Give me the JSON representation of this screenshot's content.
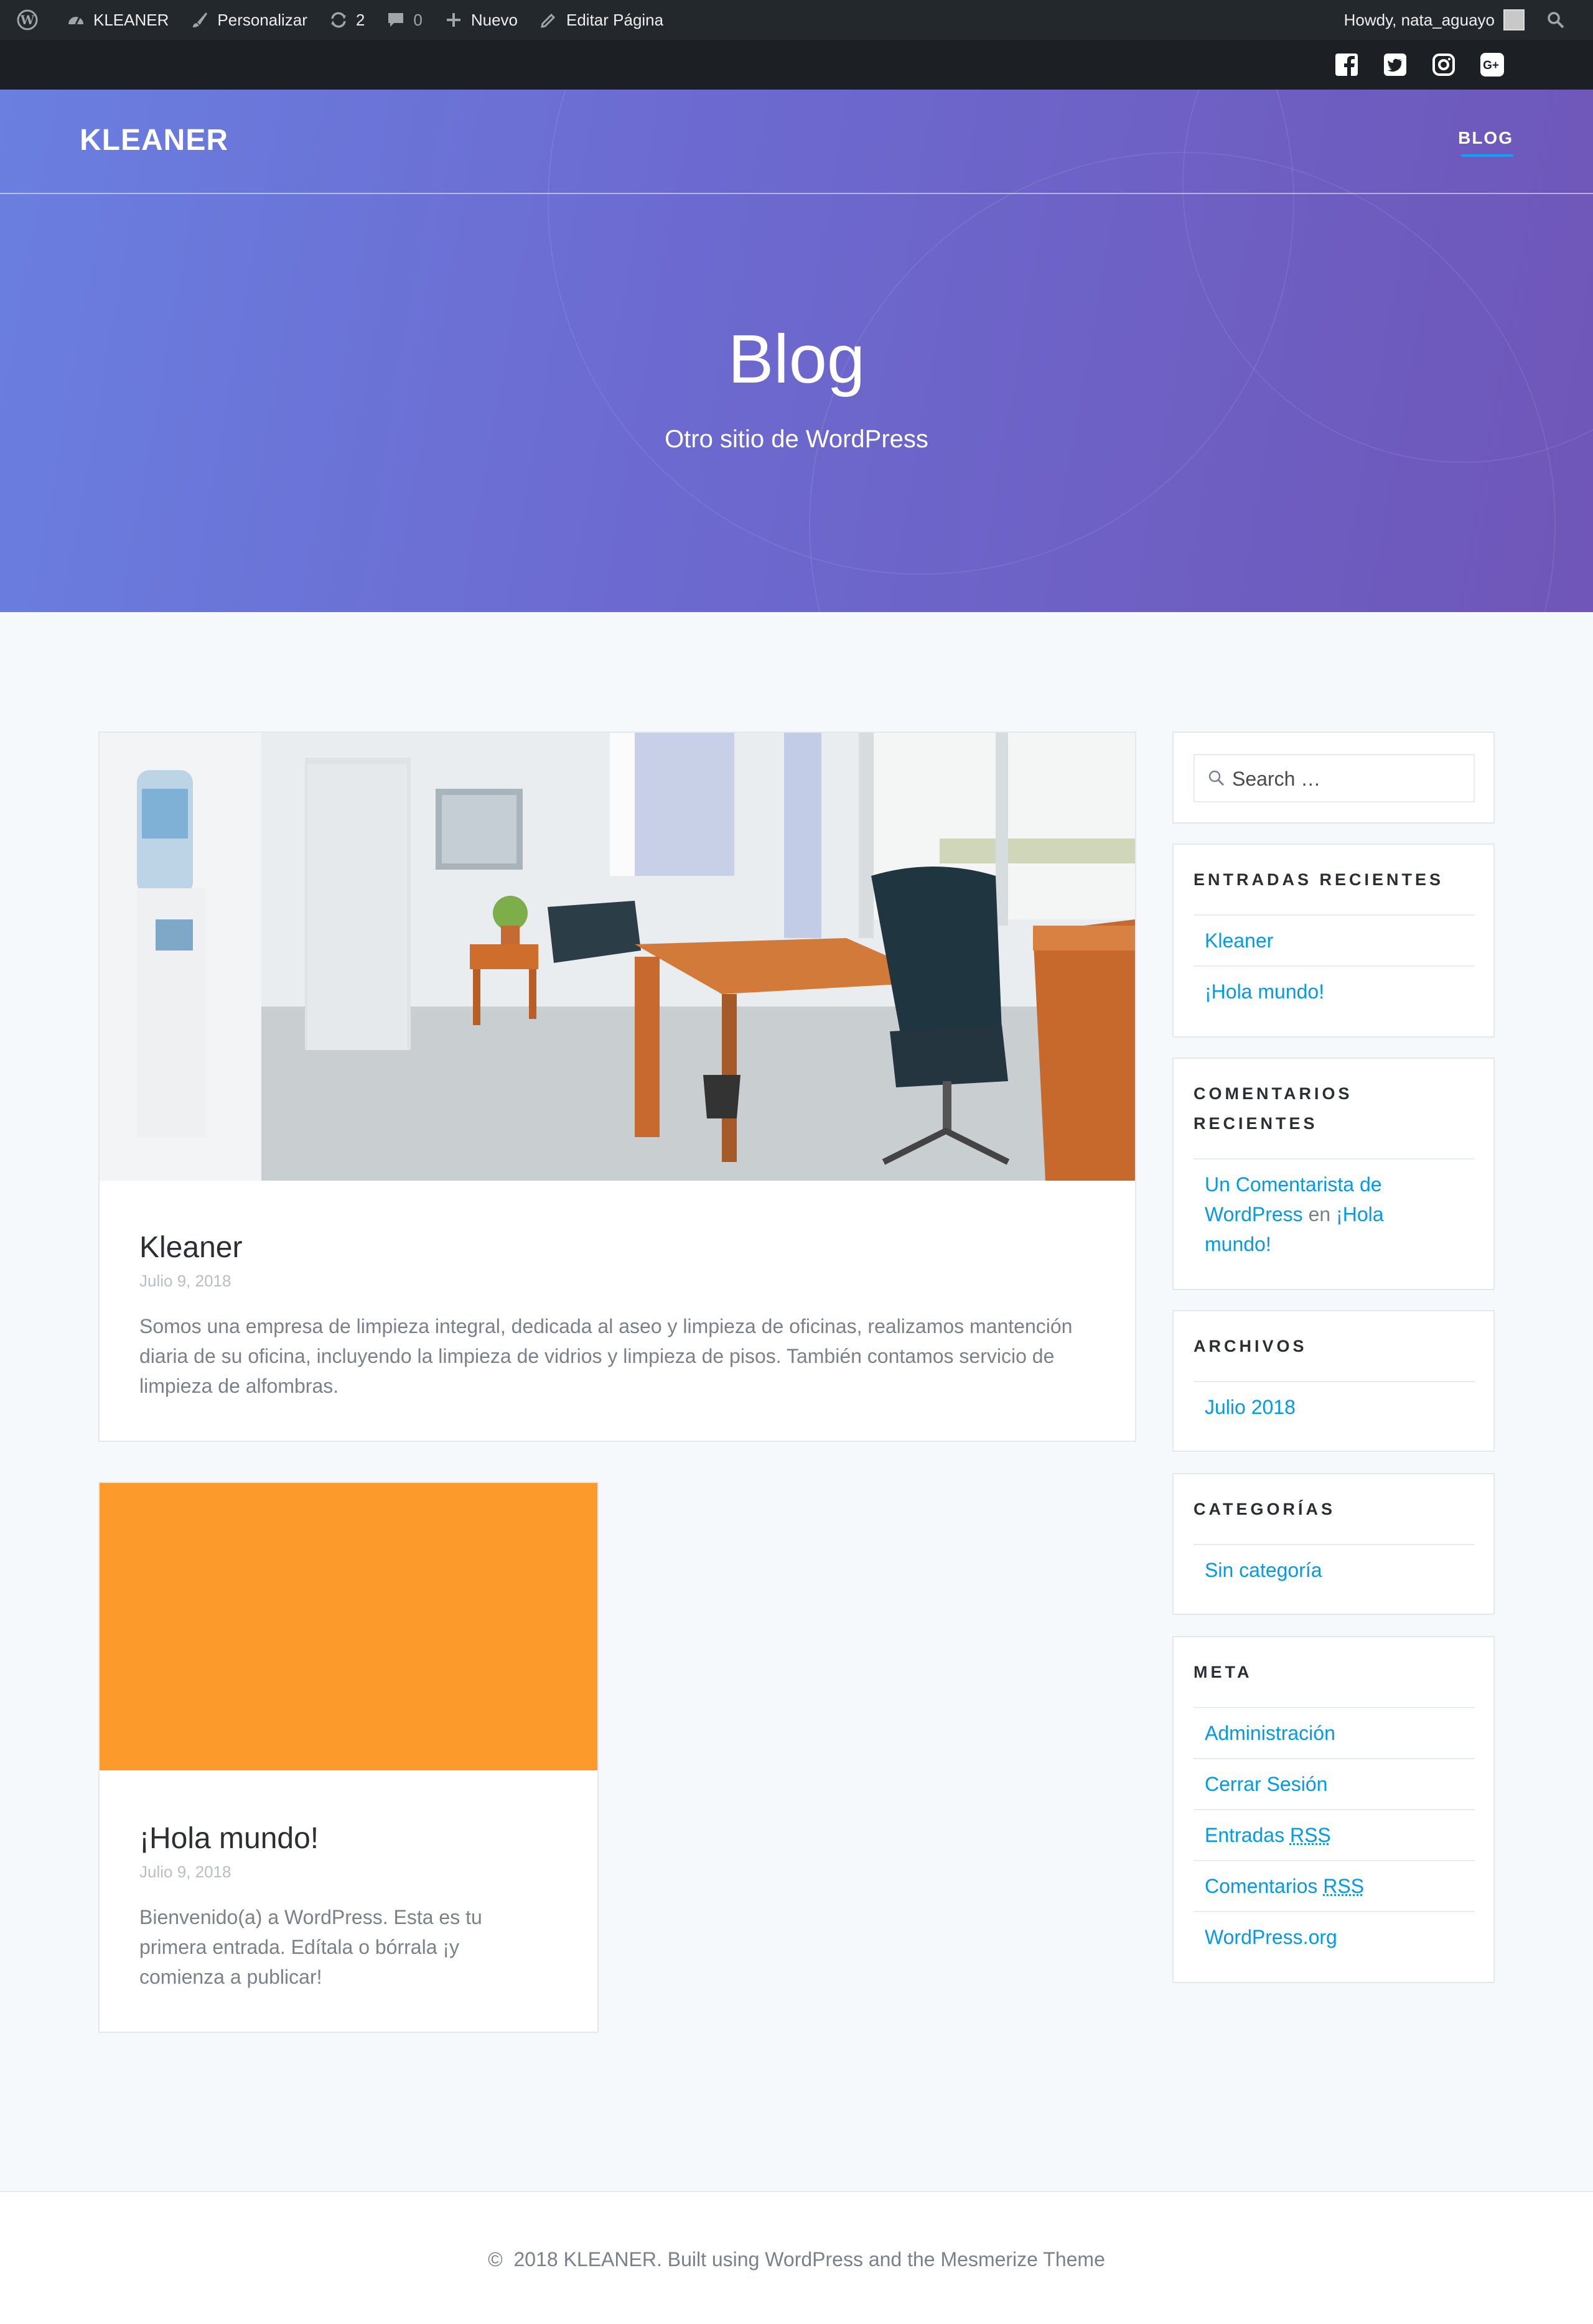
{
  "admin_bar": {
    "site_name": "KLEANER",
    "customize": "Personalizar",
    "updates_count": "2",
    "comments_count": "0",
    "new_label": "Nuevo",
    "edit_page": "Editar Página",
    "howdy": "Howdy, nata_aguayo"
  },
  "social": {
    "icons": [
      "facebook-icon",
      "twitter-icon",
      "instagram-icon",
      "google-plus-icon"
    ]
  },
  "header": {
    "logo": "KLEANER",
    "nav_item": "BLOG",
    "hero_title": "Blog",
    "hero_subtitle": "Otro sitio de WordPress"
  },
  "posts": [
    {
      "title": "Kleaner",
      "date": "Julio 9, 2018",
      "excerpt": "Somos una empresa de limpieza integral, dedicada al aseo y limpieza de oficinas, realizamos mantención diaria de su oficina, incluyendo la limpieza de vidrios y limpieza de pisos. También contamos servicio de limpieza de alfombras."
    },
    {
      "title": "¡Hola mundo!",
      "date": "Julio 9, 2018",
      "excerpt": "Bienvenido(a) a WordPress. Esta es tu primera entrada. Edítala o bórrala ¡y comienza a publicar!",
      "thumb_color": "#fd9a2c"
    }
  ],
  "sidebar": {
    "search_placeholder": "Search …",
    "recent_posts": {
      "title": "ENTRADAS RECIENTES",
      "items": [
        "Kleaner",
        "¡Hola mundo!"
      ]
    },
    "recent_comments": {
      "title_line1": "COMENTARIOS",
      "title_line2": "RECIENTES",
      "line1": "Un Comentarista de",
      "author2": "WordPress",
      "connector": " en ",
      "post": "¡Hola",
      "post2": "mundo!"
    },
    "archives": {
      "title": "ARCHIVOS",
      "items": [
        "Julio 2018"
      ]
    },
    "categories": {
      "title": "CATEGORÍAS",
      "items": [
        "Sin categoría"
      ]
    },
    "meta": {
      "title": "META",
      "admin": "Administración",
      "logout": "Cerrar Sesión",
      "entries_prefix": "Entradas ",
      "comments_prefix": "Comentarios ",
      "rss": "RSS",
      "wporg": "WordPress.org"
    }
  },
  "footer": {
    "text": "©  2018 KLEANER. Built using WordPress and the Mesmerize Theme"
  },
  "colors": {
    "accent": "#03a9f4",
    "link": "#039be5",
    "hero_start": "#6a7fe0",
    "hero_end": "#6f56b8"
  }
}
